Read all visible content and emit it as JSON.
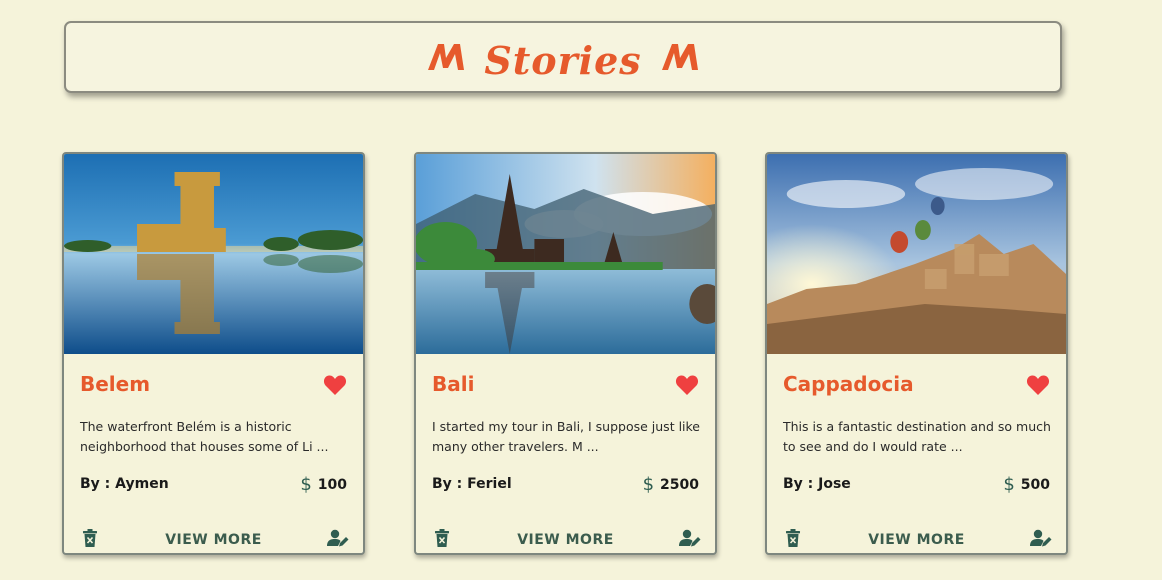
{
  "header": {
    "title": "Stories",
    "logo_icon": "double-m-logo-icon"
  },
  "colors": {
    "accent": "#e65a2c",
    "background": "#f5f3da",
    "heart": "#ef4040",
    "footer": "#3b5c4d"
  },
  "cards": [
    {
      "title": "Belem",
      "description": "The waterfront Belém is a historic neighborhood that houses some of Li ...",
      "author": "By : Aymen",
      "currency": "$",
      "price": "100",
      "view_more": "VIEW MORE",
      "image_alt": "Belem tower reflected on water"
    },
    {
      "title": "Bali",
      "description": "I started my tour in Bali, I suppose just like many other travelers. M ...",
      "author": "By : Feriel",
      "currency": "$",
      "price": "2500",
      "view_more": "VIEW MORE",
      "image_alt": "Bali temple on a lake"
    },
    {
      "title": "Cappadocia",
      "description": "This is a fantastic destination and so much to see and do I would rate ...",
      "author": "By : Jose",
      "currency": "$",
      "price": "500",
      "view_more": "VIEW MORE",
      "image_alt": "Hot air balloons over Cappadocia"
    }
  ]
}
